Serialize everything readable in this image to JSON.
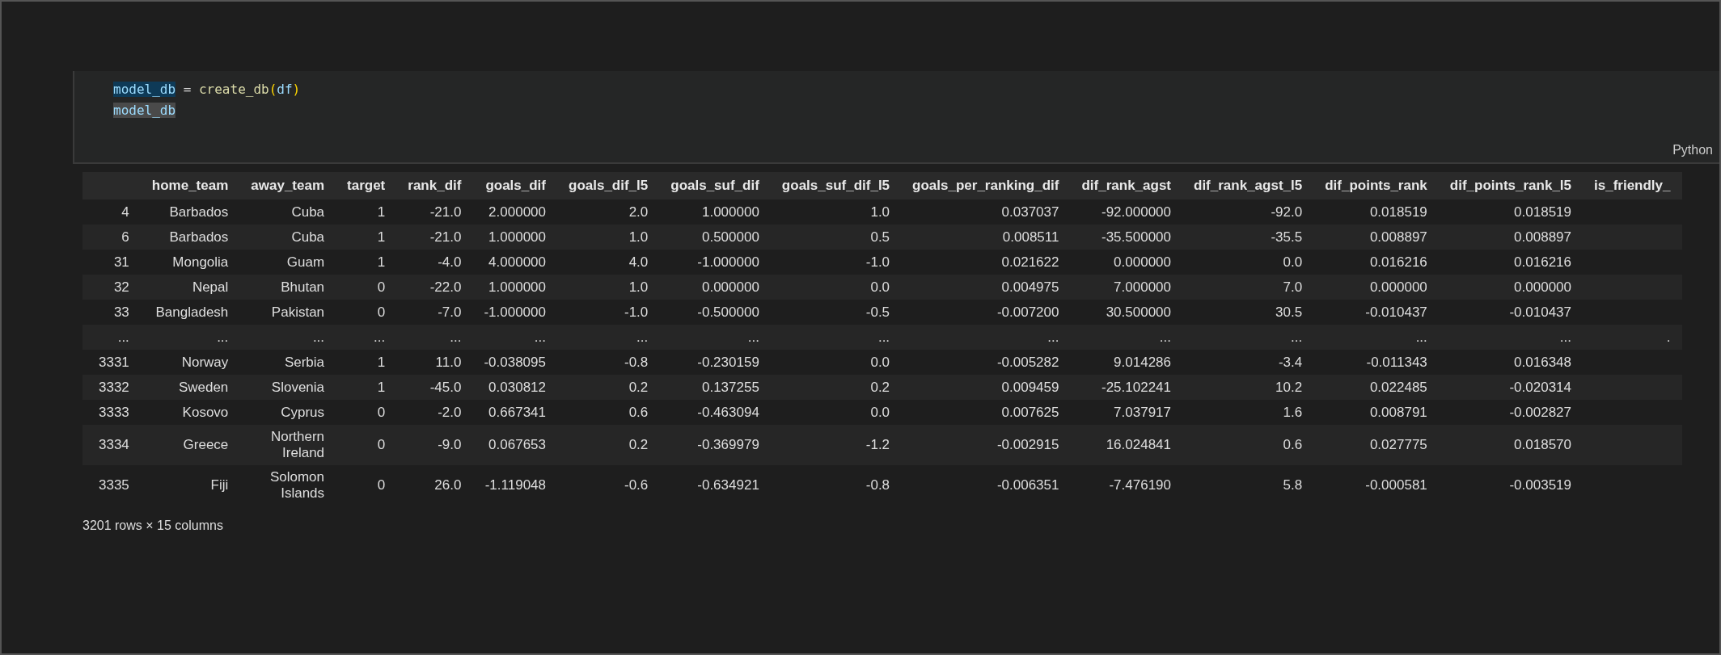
{
  "code_cell": {
    "lines": [
      [
        {
          "text": "model_db",
          "kind": "variable",
          "selected": true,
          "highlighted": false
        },
        {
          "text": " = ",
          "kind": "operator",
          "selected": false,
          "highlighted": false
        },
        {
          "text": "create_db",
          "kind": "function",
          "selected": false,
          "highlighted": false
        },
        {
          "text": "(",
          "kind": "paren",
          "selected": false,
          "highlighted": false
        },
        {
          "text": "df",
          "kind": "variable",
          "selected": false,
          "highlighted": false
        },
        {
          "text": ")",
          "kind": "paren",
          "selected": false,
          "highlighted": false
        }
      ],
      [
        {
          "text": "model_db",
          "kind": "variable",
          "selected": false,
          "highlighted": true
        }
      ]
    ],
    "language": "Python"
  },
  "table": {
    "columns": [
      "",
      "home_team",
      "away_team",
      "target",
      "rank_dif",
      "goals_dif",
      "goals_dif_l5",
      "goals_suf_dif",
      "goals_suf_dif_l5",
      "goals_per_ranking_dif",
      "dif_rank_agst",
      "dif_rank_agst_l5",
      "dif_points_rank",
      "dif_points_rank_l5",
      "is_friendly_"
    ],
    "rows": [
      [
        "4",
        "Barbados",
        "Cuba",
        "1",
        "-21.0",
        "2.000000",
        "2.0",
        "1.000000",
        "1.0",
        "0.037037",
        "-92.000000",
        "-92.0",
        "0.018519",
        "0.018519"
      ],
      [
        "6",
        "Barbados",
        "Cuba",
        "1",
        "-21.0",
        "1.000000",
        "1.0",
        "0.500000",
        "0.5",
        "0.008511",
        "-35.500000",
        "-35.5",
        "0.008897",
        "0.008897"
      ],
      [
        "31",
        "Mongolia",
        "Guam",
        "1",
        "-4.0",
        "4.000000",
        "4.0",
        "-1.000000",
        "-1.0",
        "0.021622",
        "0.000000",
        "0.0",
        "0.016216",
        "0.016216"
      ],
      [
        "32",
        "Nepal",
        "Bhutan",
        "0",
        "-22.0",
        "1.000000",
        "1.0",
        "0.000000",
        "0.0",
        "0.004975",
        "7.000000",
        "7.0",
        "0.000000",
        "0.000000"
      ],
      [
        "33",
        "Bangladesh",
        "Pakistan",
        "0",
        "-7.0",
        "-1.000000",
        "-1.0",
        "-0.500000",
        "-0.5",
        "-0.007200",
        "30.500000",
        "30.5",
        "-0.010437",
        "-0.010437"
      ],
      [
        "...",
        "...",
        "...",
        "...",
        "...",
        "...",
        "...",
        "...",
        "...",
        "...",
        "...",
        "...",
        "...",
        "...",
        "."
      ],
      [
        "3331",
        "Norway",
        "Serbia",
        "1",
        "11.0",
        "-0.038095",
        "-0.8",
        "-0.230159",
        "0.0",
        "-0.005282",
        "9.014286",
        "-3.4",
        "-0.011343",
        "0.016348"
      ],
      [
        "3332",
        "Sweden",
        "Slovenia",
        "1",
        "-45.0",
        "0.030812",
        "0.2",
        "0.137255",
        "0.2",
        "0.009459",
        "-25.102241",
        "10.2",
        "0.022485",
        "-0.020314"
      ],
      [
        "3333",
        "Kosovo",
        "Cyprus",
        "0",
        "-2.0",
        "0.667341",
        "0.6",
        "-0.463094",
        "0.0",
        "0.007625",
        "7.037917",
        "1.6",
        "0.008791",
        "-0.002827"
      ],
      [
        "3334",
        "Greece",
        "Northern Ireland",
        "0",
        "-9.0",
        "0.067653",
        "0.2",
        "-0.369979",
        "-1.2",
        "-0.002915",
        "16.024841",
        "0.6",
        "0.027775",
        "0.018570"
      ],
      [
        "3335",
        "Fiji",
        "Solomon Islands",
        "0",
        "26.0",
        "-1.119048",
        "-0.6",
        "-0.634921",
        "-0.8",
        "-0.006351",
        "-7.476190",
        "5.8",
        "-0.000581",
        "-0.003519"
      ]
    ]
  },
  "footer": "3201 rows × 15 columns"
}
